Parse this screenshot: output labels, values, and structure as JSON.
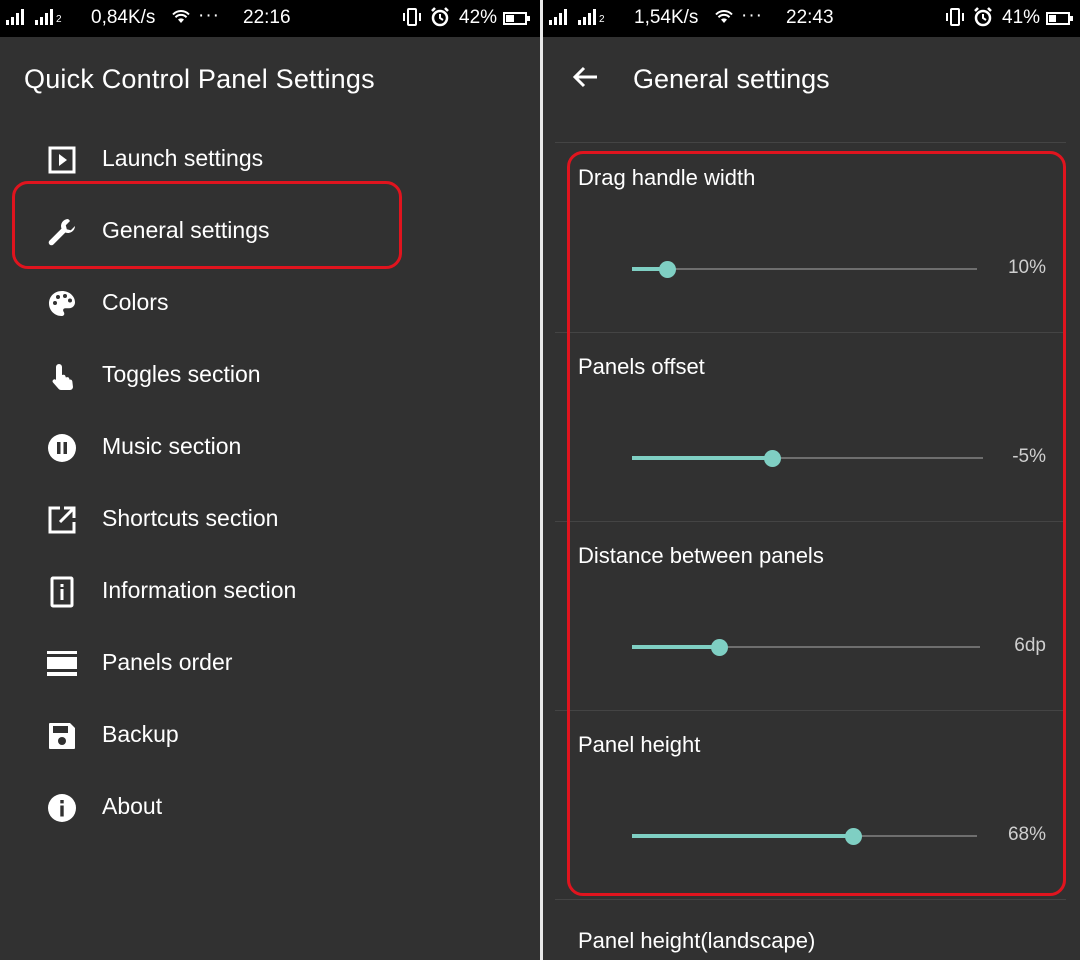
{
  "colors": {
    "accent": "#7fcfc3",
    "highlight": "#e0141e",
    "background": "#313131"
  },
  "left_status": {
    "speed": "0,84K/s",
    "dots": "···",
    "time": "22:16",
    "battery": "42%",
    "battery_level": 0.42
  },
  "right_status": {
    "speed": "1,54K/s",
    "dots": "···",
    "time": "22:43",
    "battery": "41%",
    "battery_level": 0.41
  },
  "left": {
    "title": "Quick Control Panel Settings",
    "menu": [
      {
        "label": "Launch settings",
        "icon": "play-box-icon"
      },
      {
        "label": "General settings",
        "icon": "wrench-icon"
      },
      {
        "label": "Colors",
        "icon": "palette-icon"
      },
      {
        "label": "Toggles section",
        "icon": "touch-icon"
      },
      {
        "label": "Music section",
        "icon": "pause-circle-icon"
      },
      {
        "label": "Shortcuts section",
        "icon": "open-in-new-icon"
      },
      {
        "label": "Information section",
        "icon": "info-box-icon"
      },
      {
        "label": "Panels order",
        "icon": "view-stream-icon"
      },
      {
        "label": "Backup",
        "icon": "save-icon"
      },
      {
        "label": "About",
        "icon": "info-circle-icon"
      }
    ]
  },
  "right": {
    "title": "General settings",
    "back_icon": "arrow-left-icon",
    "settings": [
      {
        "label": "Drag handle width",
        "value": "10%",
        "fraction": 0.1
      },
      {
        "label": "Panels offset",
        "value": "-5%",
        "fraction": 0.4
      },
      {
        "label": "Distance between panels",
        "value": "6dp",
        "fraction": 0.25
      },
      {
        "label": "Panel height",
        "value": "68%",
        "fraction": 0.64
      }
    ],
    "partial_label": "Panel height(landscape)"
  }
}
